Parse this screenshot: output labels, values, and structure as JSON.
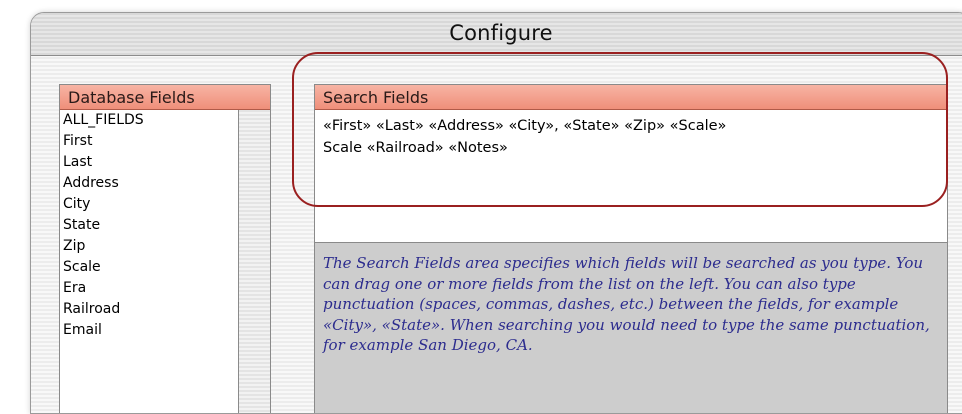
{
  "window": {
    "title": "Configure"
  },
  "database_fields": {
    "header": "Database Fields",
    "items": [
      "ALL_FIELDS",
      "First",
      "Last",
      "Address",
      "City",
      "State",
      "Zip",
      "Scale",
      "Era",
      "Railroad",
      "Email"
    ]
  },
  "search_fields": {
    "header": "Search Fields",
    "value": "«First» «Last» «Address» «City», «State» «Zip» «Scale»\nScale «Railroad» «Notes»",
    "help": "The Search Fields area specifies which fields will be searched as you type. You can drag one or more fields from the list on the left. You can also type punctuation (spaces, commas, dashes, etc.) between the fields, for example «City», «State». When searching you would need to type the same punctuation, for example San Diego, CA."
  },
  "colors": {
    "header_accent": "#ef8f7a",
    "help_text": "#2c2c8e",
    "callout": "#9a2020"
  }
}
